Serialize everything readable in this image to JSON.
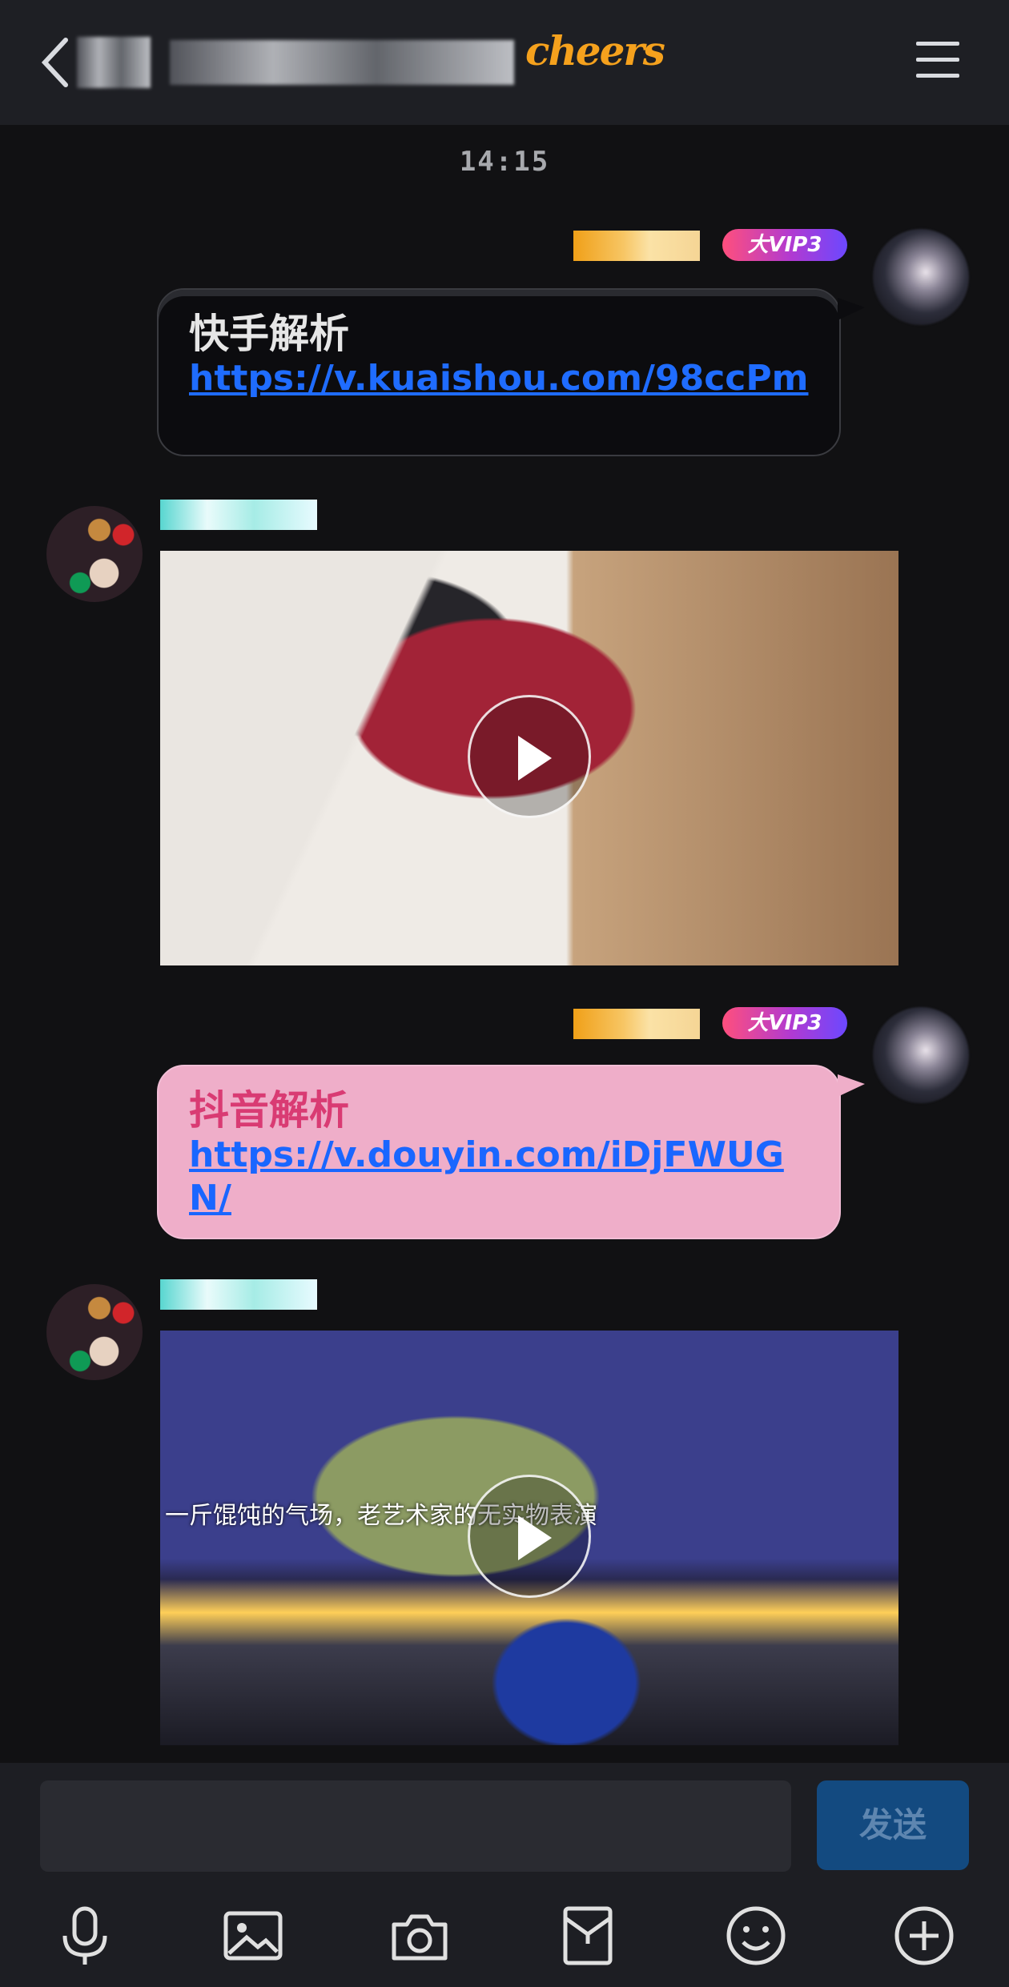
{
  "header": {
    "brand": "cheers"
  },
  "chat": {
    "time": "14:15",
    "messages": [
      {
        "vip": "大VIP3",
        "title": "快手解析",
        "link": "https://v.kuaishou.com/98ccPm"
      },
      {
        "type": "video"
      },
      {
        "vip": "大VIP3",
        "title": "抖音解析",
        "link": "https://v.douyin.com/iDjFWUGN/"
      },
      {
        "type": "video",
        "caption": "一斤馄饨的气场，老艺术家的无实物表演"
      }
    ]
  },
  "input": {
    "placeholder": "",
    "send_label": "发送"
  },
  "toolbar": {
    "items": [
      "mic-icon",
      "image-icon",
      "camera-icon",
      "red-packet-icon",
      "emoji-icon",
      "plus-icon"
    ]
  }
}
